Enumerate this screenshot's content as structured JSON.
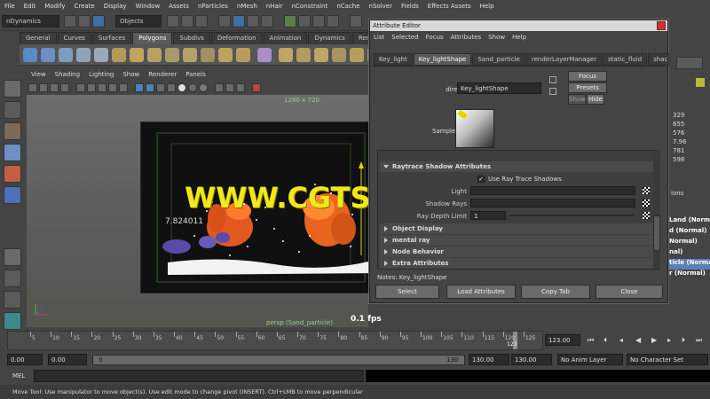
{
  "menubar": [
    "File",
    "Edit",
    "Modify",
    "Create",
    "Display",
    "Window",
    "Assets",
    "nParticles",
    "nMesh",
    "nHair",
    "nConstraint",
    "nCache",
    "nSolver",
    "Fields",
    "Effects Assets",
    "Help"
  ],
  "statusline": {
    "module": "nDynamics",
    "selection_mode": "Objects"
  },
  "shelf_tabs": [
    {
      "label": "General",
      "active": false
    },
    {
      "label": "Curves",
      "active": false
    },
    {
      "label": "Surfaces",
      "active": false
    },
    {
      "label": "Polygons",
      "active": true
    },
    {
      "label": "Subdivs",
      "active": false
    },
    {
      "label": "Deformation",
      "active": false
    },
    {
      "label": "Animation",
      "active": false
    },
    {
      "label": "Dynamics",
      "active": false
    },
    {
      "label": "Rendering",
      "active": false
    }
  ],
  "viewport": {
    "menu": [
      "View",
      "Shading",
      "Lighting",
      "Show",
      "Renderer",
      "Panels"
    ],
    "resolution": "1280 x 720",
    "camera_label": "persp (Sand_particle)",
    "value_readout": "7.824011",
    "fps": "0.1 fps"
  },
  "attribute_editor": {
    "title": "Attribute Editor",
    "menu": [
      "List",
      "Selected",
      "Focus",
      "Attributes",
      "Show",
      "Help"
    ],
    "tabs": [
      {
        "label": "Key_light",
        "active": false
      },
      {
        "label": "Key_lightShape",
        "active": true
      },
      {
        "label": "Sand_particle",
        "active": false
      },
      {
        "label": "renderLayerManager",
        "active": false
      },
      {
        "label": "static_fluid",
        "active": false
      },
      {
        "label": "shac",
        "active": false
      }
    ],
    "node_type_label": "directionalLight:",
    "node_name": "Key_lightShape",
    "focus_label": "Focus",
    "presets_label": "Presets",
    "show_label": "Show",
    "hide_label": "Hide",
    "sample_label": "Sample",
    "raytrace_section": "Raytrace Shadow Attributes",
    "use_raytrace_label": "Use Ray Trace Shadows",
    "use_raytrace_checked": true,
    "light_angle_label": "Light",
    "shadow_rays_label": "Shadow Rays",
    "ray_depth_label": "Ray Depth Limit",
    "ray_depth_value": "1",
    "sections": [
      "Object Display",
      "mental ray",
      "Node Behavior",
      "Extra Attributes"
    ],
    "notes_label": "Notes:  Key_lightShape",
    "buttons": {
      "select": "Select",
      "load": "Load Attributes",
      "copy": "Copy Tab",
      "close": "Close"
    }
  },
  "right_panel": {
    "values": [
      "329",
      "655",
      "576",
      "7.96",
      "781",
      "598"
    ],
    "layers_label": "ions",
    "layer_items": [
      "Land (Normal)",
      "d (Normal)",
      "Normal)",
      "nal)",
      "ticle (Normal)",
      "r (Normal)"
    ]
  },
  "timeline": {
    "ticks": [
      "5",
      "10",
      "15",
      "20",
      "25",
      "30",
      "35",
      "40",
      "45",
      "50",
      "55",
      "60",
      "65",
      "70",
      "75",
      "80",
      "85",
      "90",
      "95",
      "100",
      "105",
      "110",
      "115",
      "120",
      "125"
    ],
    "current_marker": "123",
    "current_frame": "123.00"
  },
  "range": {
    "start": "0.00",
    "playback_start": "0.00",
    "slider_min": "0",
    "slider_max": "130",
    "playback_end": "130.00",
    "end": "130.00",
    "anim_layer": "No Anim Layer",
    "char_set": "No Character Set"
  },
  "command_line": {
    "label": "MEL"
  },
  "help_line": "Move Tool: Use manipulator to move object(s). Use edit mode to change pivot (INSERT). Ctrl+LMB to move perpendicular",
  "watermark": "WWW.CGTSJ.COM"
}
